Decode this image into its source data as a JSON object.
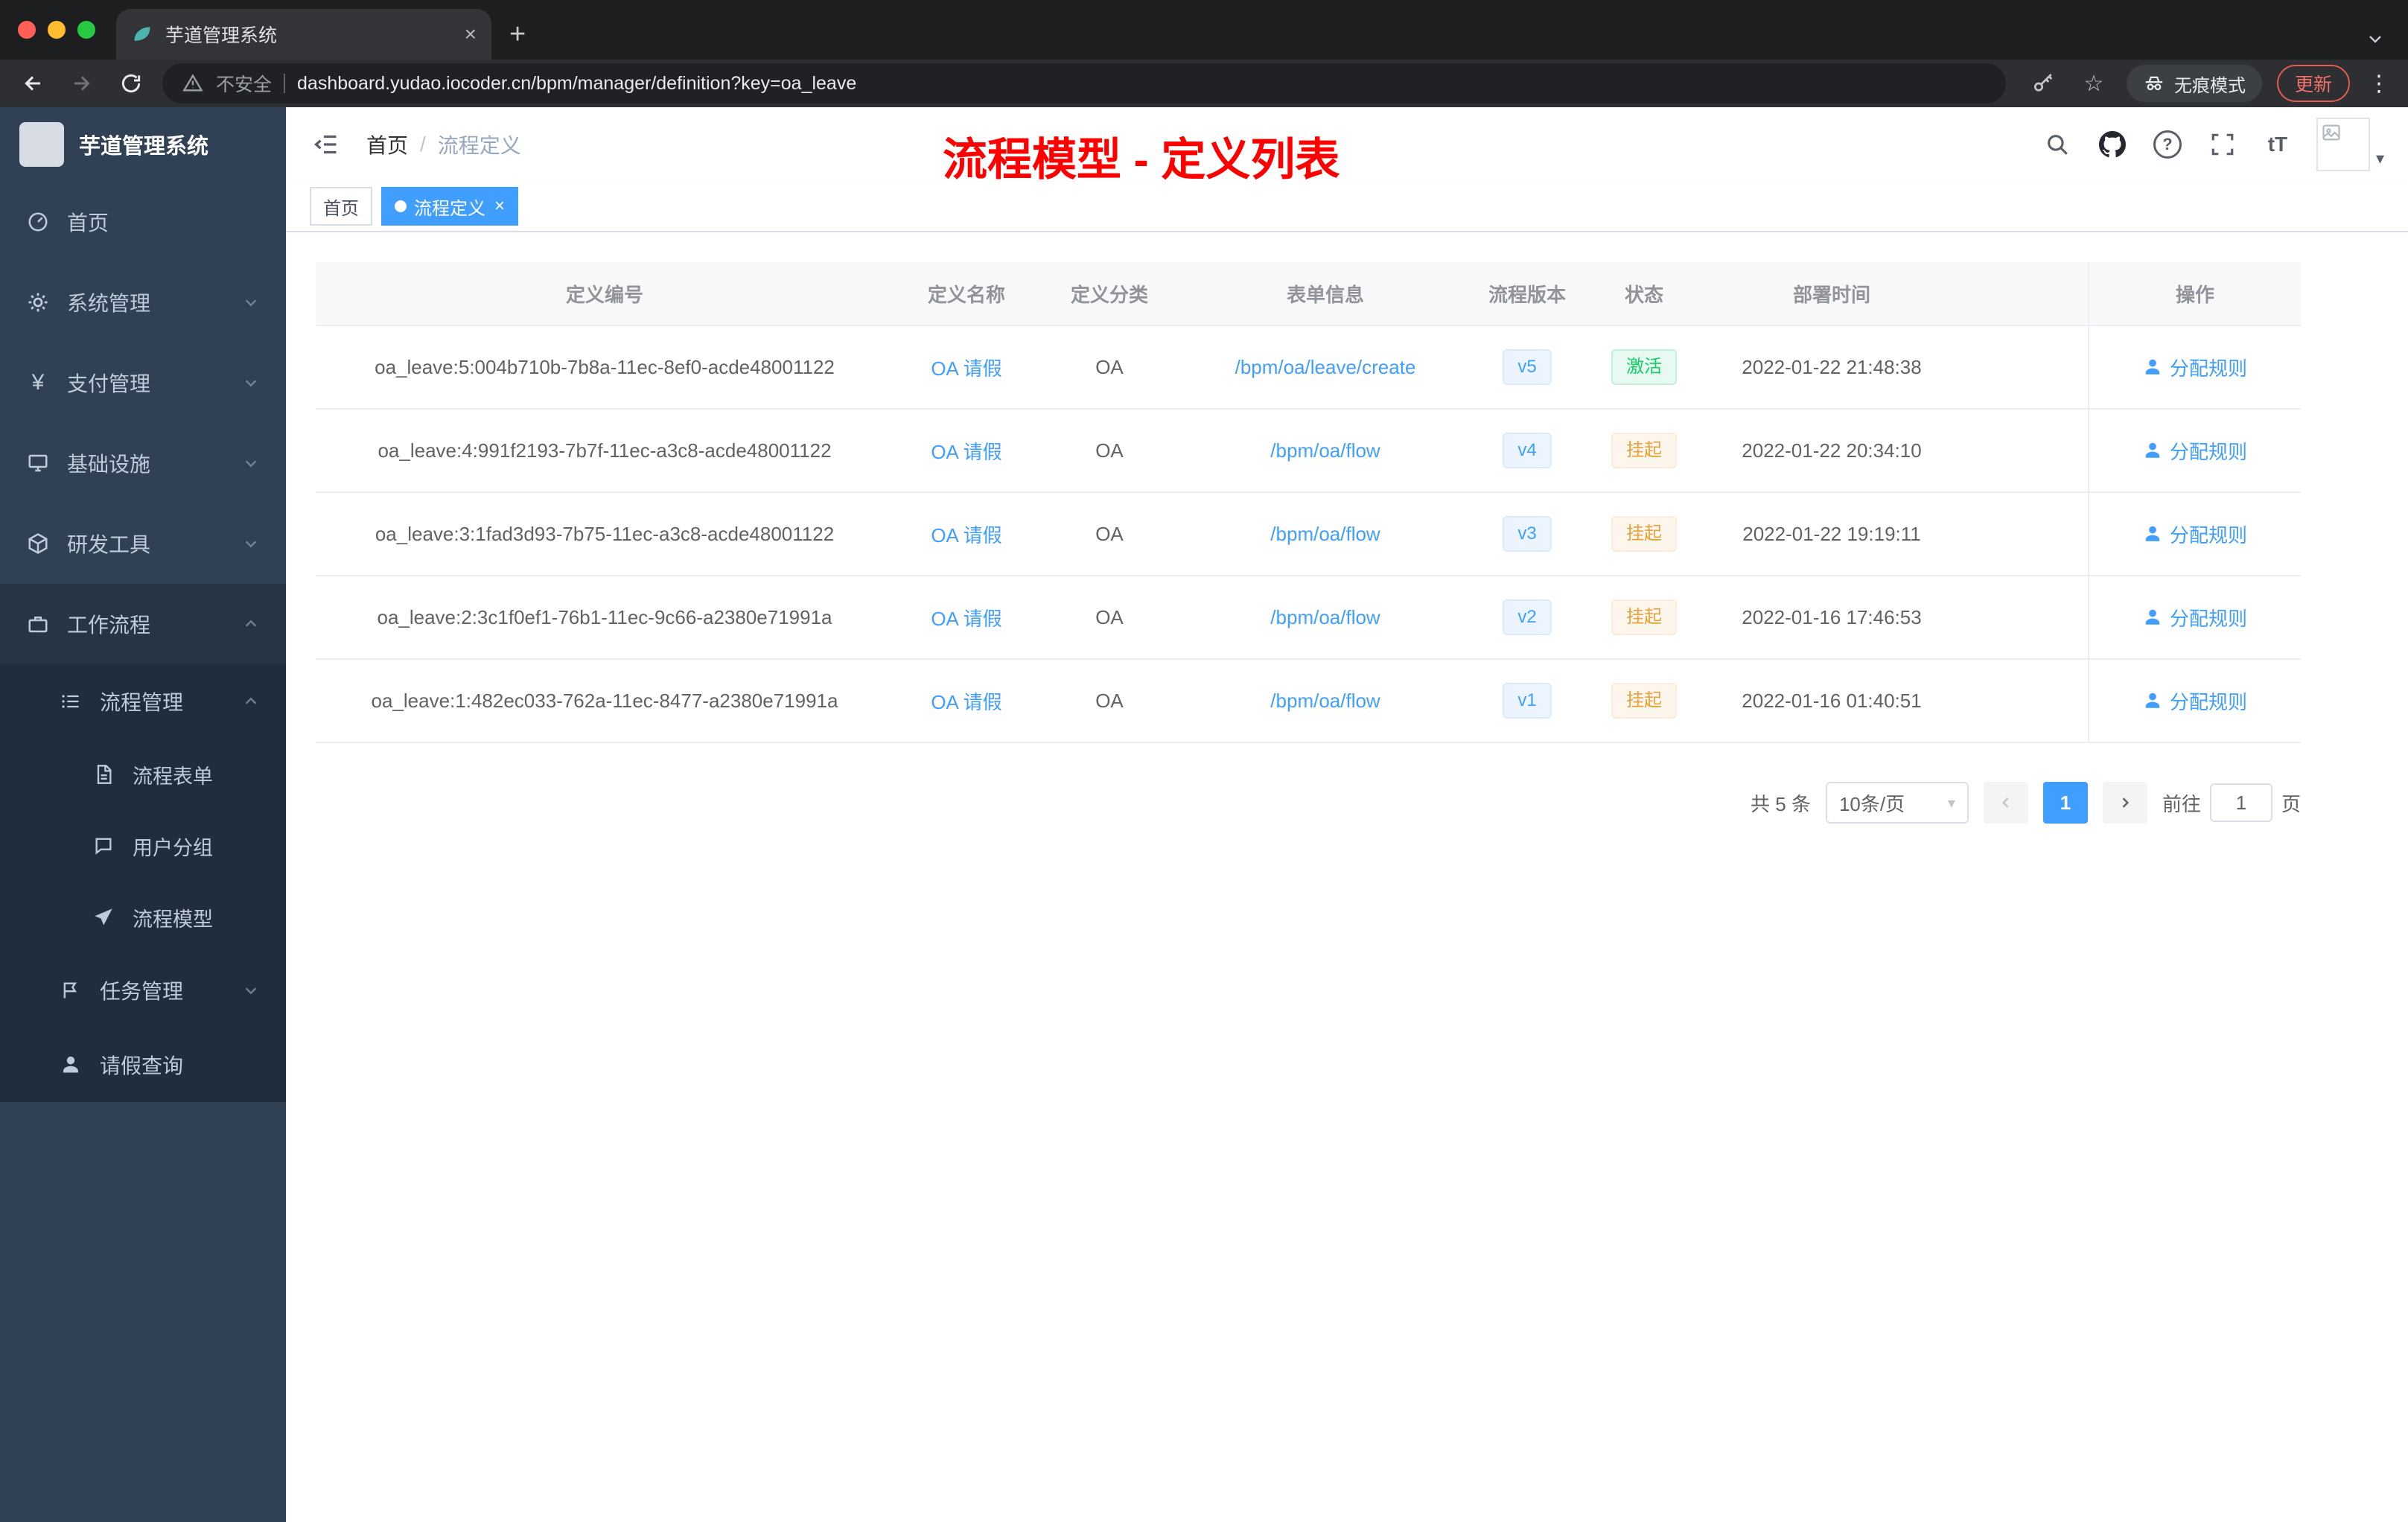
{
  "colors": {
    "accent": "#409eff",
    "success": "#13ce66",
    "warning": "#e6a23c",
    "annotation_red": "#fe0000",
    "sidebar_bg": "#304156",
    "submenu_bg": "#1f2d3d"
  },
  "glyphs": {
    "close": "×",
    "plus": "+",
    "star": "☆",
    "kebab": "⋮",
    "question": "?",
    "font_size": "tT",
    "caret": "▾",
    "slash": "/",
    "yen": "¥"
  },
  "browser": {
    "tab_title": "芋道管理系统",
    "security_label": "不安全",
    "url": "dashboard.yudao.iocoder.cn/bpm/manager/definition?key=oa_leave",
    "incognito_label": "无痕模式",
    "update_label": "更新"
  },
  "sidebar": {
    "logo_title": "芋道管理系统",
    "items": [
      {
        "label": "首页"
      },
      {
        "label": "系统管理"
      },
      {
        "label": "支付管理"
      },
      {
        "label": "基础设施"
      },
      {
        "label": "研发工具"
      },
      {
        "label": "工作流程"
      }
    ],
    "sub": {
      "process_mgmt": "流程管理",
      "process_form": "流程表单",
      "user_group": "用户分组",
      "process_model": "流程模型",
      "task_mgmt": "任务管理",
      "leave_query": "请假查询"
    }
  },
  "header": {
    "breadcrumb_home": "首页",
    "breadcrumb_current": "流程定义",
    "annotation": "流程模型 - 定义列表"
  },
  "tags": {
    "home": "首页",
    "active": "流程定义"
  },
  "table": {
    "columns": [
      "定义编号",
      "定义名称",
      "定义分类",
      "表单信息",
      "流程版本",
      "状态",
      "部署时间",
      "操作"
    ],
    "action_label": "分配规则",
    "rows": [
      {
        "id": "oa_leave:5:004b710b-7b8a-11ec-8ef0-acde48001122",
        "name": "OA 请假",
        "category": "OA",
        "form": "/bpm/oa/leave/create",
        "version": "v5",
        "status": "激活",
        "time": "2022-01-22 21:48:38"
      },
      {
        "id": "oa_leave:4:991f2193-7b7f-11ec-a3c8-acde48001122",
        "name": "OA 请假",
        "category": "OA",
        "form": "/bpm/oa/flow",
        "version": "v4",
        "status": "挂起",
        "time": "2022-01-22 20:34:10"
      },
      {
        "id": "oa_leave:3:1fad3d93-7b75-11ec-a3c8-acde48001122",
        "name": "OA 请假",
        "category": "OA",
        "form": "/bpm/oa/flow",
        "version": "v3",
        "status": "挂起",
        "time": "2022-01-22 19:19:11"
      },
      {
        "id": "oa_leave:2:3c1f0ef1-76b1-11ec-9c66-a2380e71991a",
        "name": "OA 请假",
        "category": "OA",
        "form": "/bpm/oa/flow",
        "version": "v2",
        "status": "挂起",
        "time": "2022-01-16 17:46:53"
      },
      {
        "id": "oa_leave:1:482ec033-762a-11ec-8477-a2380e71991a",
        "name": "OA 请假",
        "category": "OA",
        "form": "/bpm/oa/flow",
        "version": "v1",
        "status": "挂起",
        "time": "2022-01-16 01:40:51"
      }
    ]
  },
  "pagination": {
    "total": "共 5 条",
    "page_size": "10条/页",
    "page": "1",
    "goto": "前往",
    "goto_value": "1",
    "unit": "页"
  }
}
